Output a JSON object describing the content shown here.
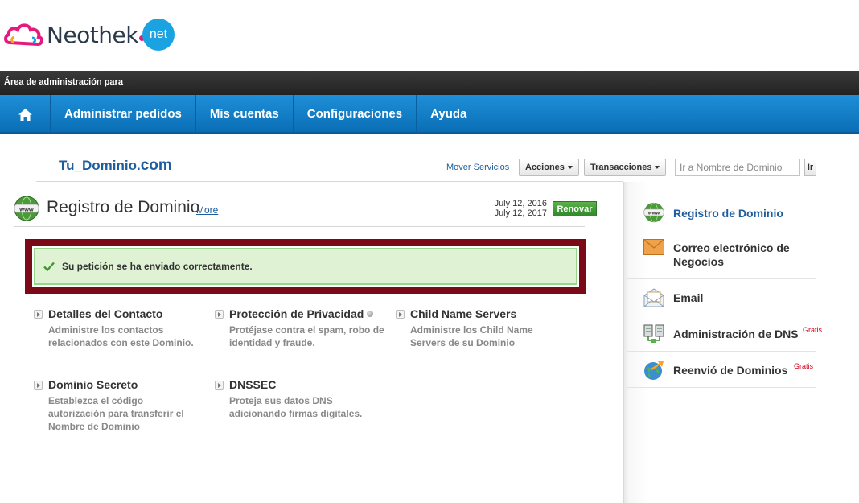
{
  "logo": {
    "text": "Neothek",
    "net": "net"
  },
  "admin_bar": {
    "label": "Área de administración para"
  },
  "nav": {
    "items": [
      "Administrar pedidos",
      "Mis cuentas",
      "Configuraciones",
      "Ayuda"
    ]
  },
  "domain": {
    "name": "Tu_Dominio.",
    "tld": "com"
  },
  "toolbar": {
    "mover_label": "Mover Servicios",
    "acciones_label": "Acciones",
    "transacciones_label": "Transacciones",
    "search_placeholder": "Ir a Nombre de Dominio",
    "go_label": "Ir"
  },
  "page": {
    "title": "Registro de Dominio",
    "more_label": "More",
    "date_start": "July 12, 2016",
    "date_end": "July 12, 2017",
    "renew_label": "Renovar"
  },
  "message": {
    "text": "Su petición se ha enviado correctamente."
  },
  "features": [
    {
      "title": "Detalles del Contacto",
      "desc": "Administre los contactos relacionados con este Dominio."
    },
    {
      "title": "Protección de Privacidad",
      "desc": "Protéjase contra el spam, robo de identidad y fraude."
    },
    {
      "title": "Child Name Servers",
      "desc": "Administre los Child Name Servers de su Dominio"
    },
    {
      "title": "Dominio Secreto",
      "desc": "Establezca el código autorización para transferir el Nombre de Dominio"
    },
    {
      "title": "DNSSEC",
      "desc": "Proteja sus datos DNS adicionando firmas digitales."
    }
  ],
  "sidebar": {
    "items": [
      {
        "label": "Registro de Dominio",
        "icon": "www-globe-icon"
      },
      {
        "label": "Correo electrónico de Negocios",
        "icon": "envelope-icon"
      },
      {
        "label": "Email",
        "icon": "open-envelope-icon"
      },
      {
        "label": "Administración de DNS",
        "icon": "dns-servers-icon",
        "badge": "Gratis"
      },
      {
        "label": "Reenvió de Dominios",
        "icon": "globe-arrow-icon",
        "badge": "Gratis"
      }
    ]
  },
  "colors": {
    "nav_blue": "#1383cf",
    "link_blue": "#1f5e9e",
    "success_bg": "#dff3d4",
    "highlight_frame": "#7a0a17",
    "renew_green": "#3e9a35"
  }
}
